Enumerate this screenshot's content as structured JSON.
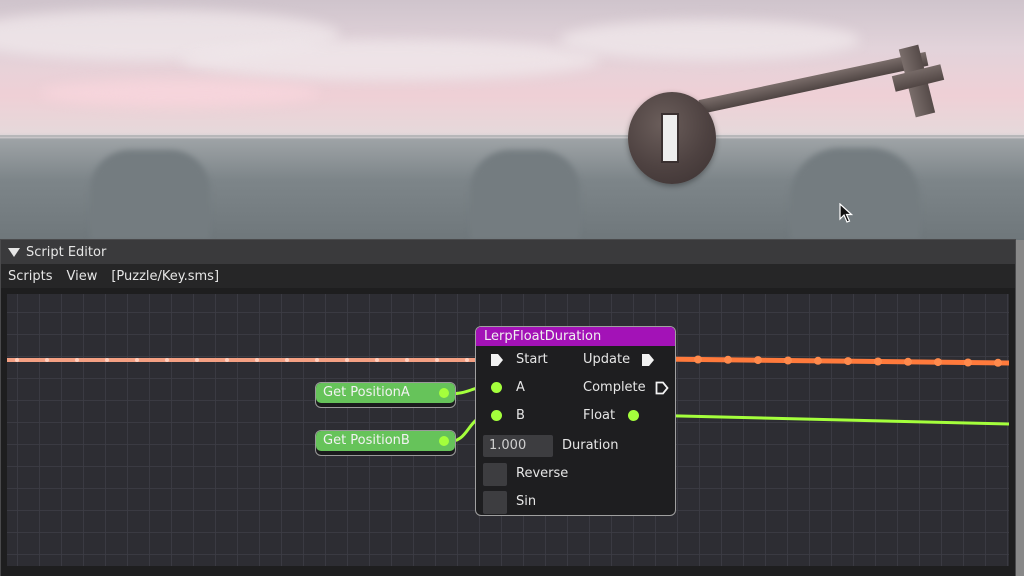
{
  "window": {
    "title": "Script Editor"
  },
  "menubar": {
    "items": [
      "Scripts",
      "View",
      "[Puzzle/Key.sms]"
    ]
  },
  "nodes": {
    "get_a": {
      "label": "Get PositionA"
    },
    "get_b": {
      "label": "Get PositionB"
    },
    "lerp": {
      "title": "LerpFloatDuration",
      "inputs": {
        "start": "Start",
        "a": "A",
        "b": "B"
      },
      "outputs": {
        "update": "Update",
        "complete": "Complete",
        "float": "Float"
      },
      "duration": {
        "value": "1.000",
        "label": "Duration"
      },
      "reverse": {
        "label": "Reverse",
        "checked": false
      },
      "sin": {
        "label": "Sin",
        "checked": false
      }
    }
  },
  "colors": {
    "exec_wire_in": "#f4a083",
    "exec_wire_out": "#ff7a3c",
    "float_wire": "#a4ff3c",
    "lerp_header": "#a312b7",
    "get_header": "#66c35a"
  },
  "icons": [
    "collapse-triangle-icon",
    "mouse-cursor-icon",
    "exec-pin-icon",
    "data-pin-icon"
  ]
}
